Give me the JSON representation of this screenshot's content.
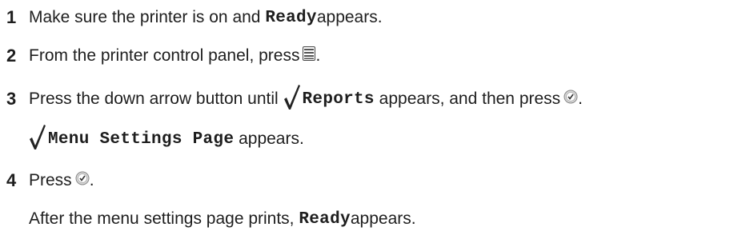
{
  "steps": [
    {
      "number": "1",
      "pre": "Make sure the printer is on and ",
      "code": "Ready",
      "post": " appears."
    },
    {
      "number": "2",
      "pre": "From the printer control panel, press",
      "icon": "menu-icon",
      "post": "."
    },
    {
      "number": "3",
      "pre": "Press the down arrow button until ",
      "icon_check": "checkmark-icon",
      "code": "Reports",
      "mid": " appears, and then press",
      "icon": "select-icon",
      "post": "."
    },
    {
      "number": "4",
      "pre": "Press",
      "icon": "select-icon",
      "post": "."
    }
  ],
  "notes": {
    "step3_result": {
      "icon_check": "checkmark-icon",
      "code": "Menu Settings Page",
      "post": " appears."
    },
    "step4_result": {
      "pre": "After the menu settings page prints, ",
      "code": "Ready",
      "post": " appears."
    }
  }
}
